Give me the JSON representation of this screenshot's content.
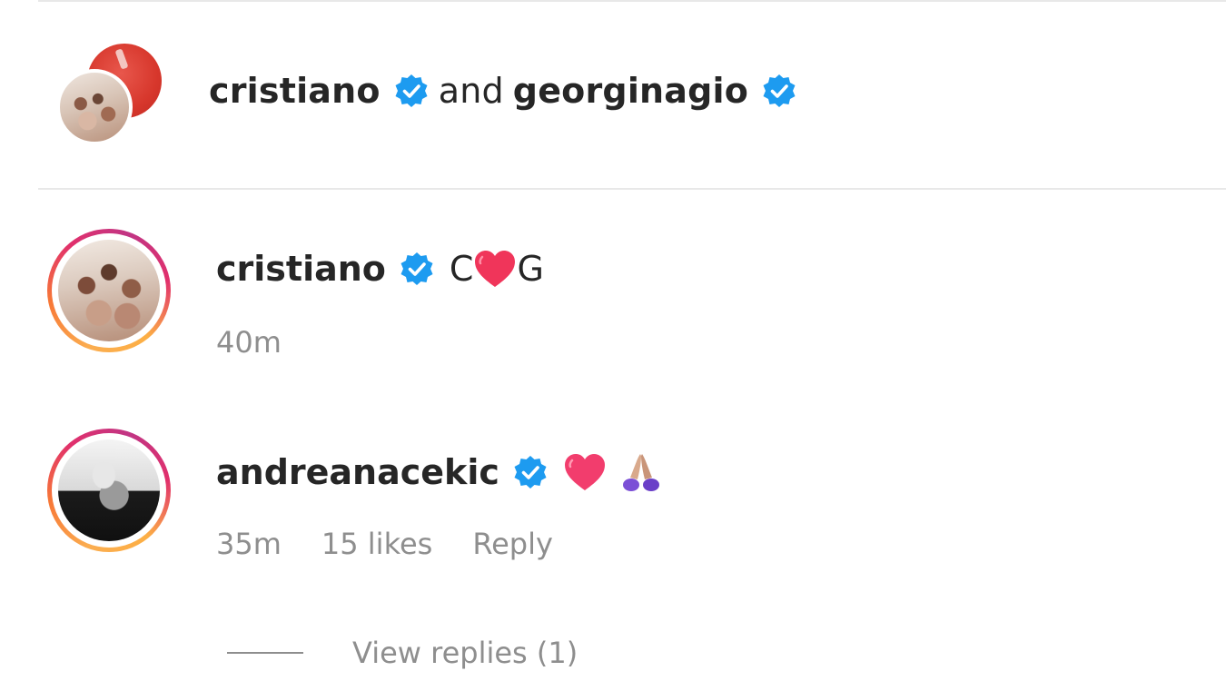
{
  "header": {
    "user1": "cristiano",
    "connector": "and",
    "user2": "georginagio"
  },
  "comments": [
    {
      "username": "cristiano",
      "text_before": "C",
      "emoji": "heart",
      "text_after": "G",
      "time": "40m"
    },
    {
      "username": "andreanacekic",
      "emojis": [
        "heart",
        "folded-hands"
      ],
      "time": "35m",
      "likes": "15 likes",
      "reply_label": "Reply"
    }
  ],
  "view_replies": "View replies (1)",
  "colors": {
    "verified": "#1d9bf0",
    "heart": "#f0355a",
    "meta_text": "#8e8e8e",
    "primary_text": "#262626"
  }
}
